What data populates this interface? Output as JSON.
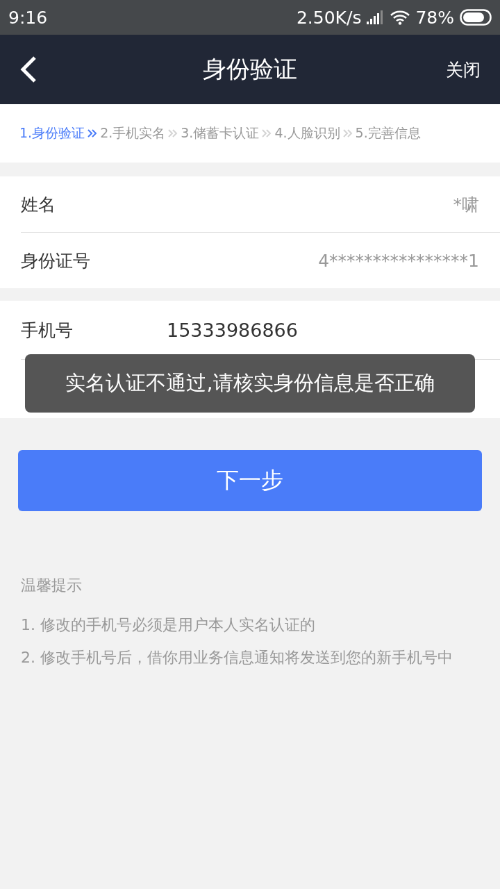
{
  "status_bar": {
    "time": "9:16",
    "speed": "2.50K/s",
    "battery": "78%"
  },
  "nav": {
    "title": "身份验证",
    "close": "关闭"
  },
  "steps": [
    {
      "label": "1.身份验证",
      "selected": true
    },
    {
      "label": "2.手机实名",
      "selected": false
    },
    {
      "label": "3.储蓄卡认证",
      "selected": false
    },
    {
      "label": "4.人脸识别",
      "selected": false
    },
    {
      "label": "5.完善信息",
      "selected": false
    }
  ],
  "identity": [
    {
      "label": "姓名",
      "value": "*啸"
    },
    {
      "label": "身份证号",
      "value": "4****************1"
    }
  ],
  "phone": {
    "label": "手机号",
    "value": "15333986866"
  },
  "toast": "实名认证不通过,请核实身份信息是否正确",
  "next_button": "下一步",
  "tips": {
    "title": "温馨提示",
    "items": [
      {
        "number": "1.",
        "text": "修改的手机号必须是用户本人实名认证的"
      },
      {
        "number": "2.",
        "text": "修改手机号后，借你用业务信息通知将发送到您的新手机号中"
      }
    ]
  }
}
